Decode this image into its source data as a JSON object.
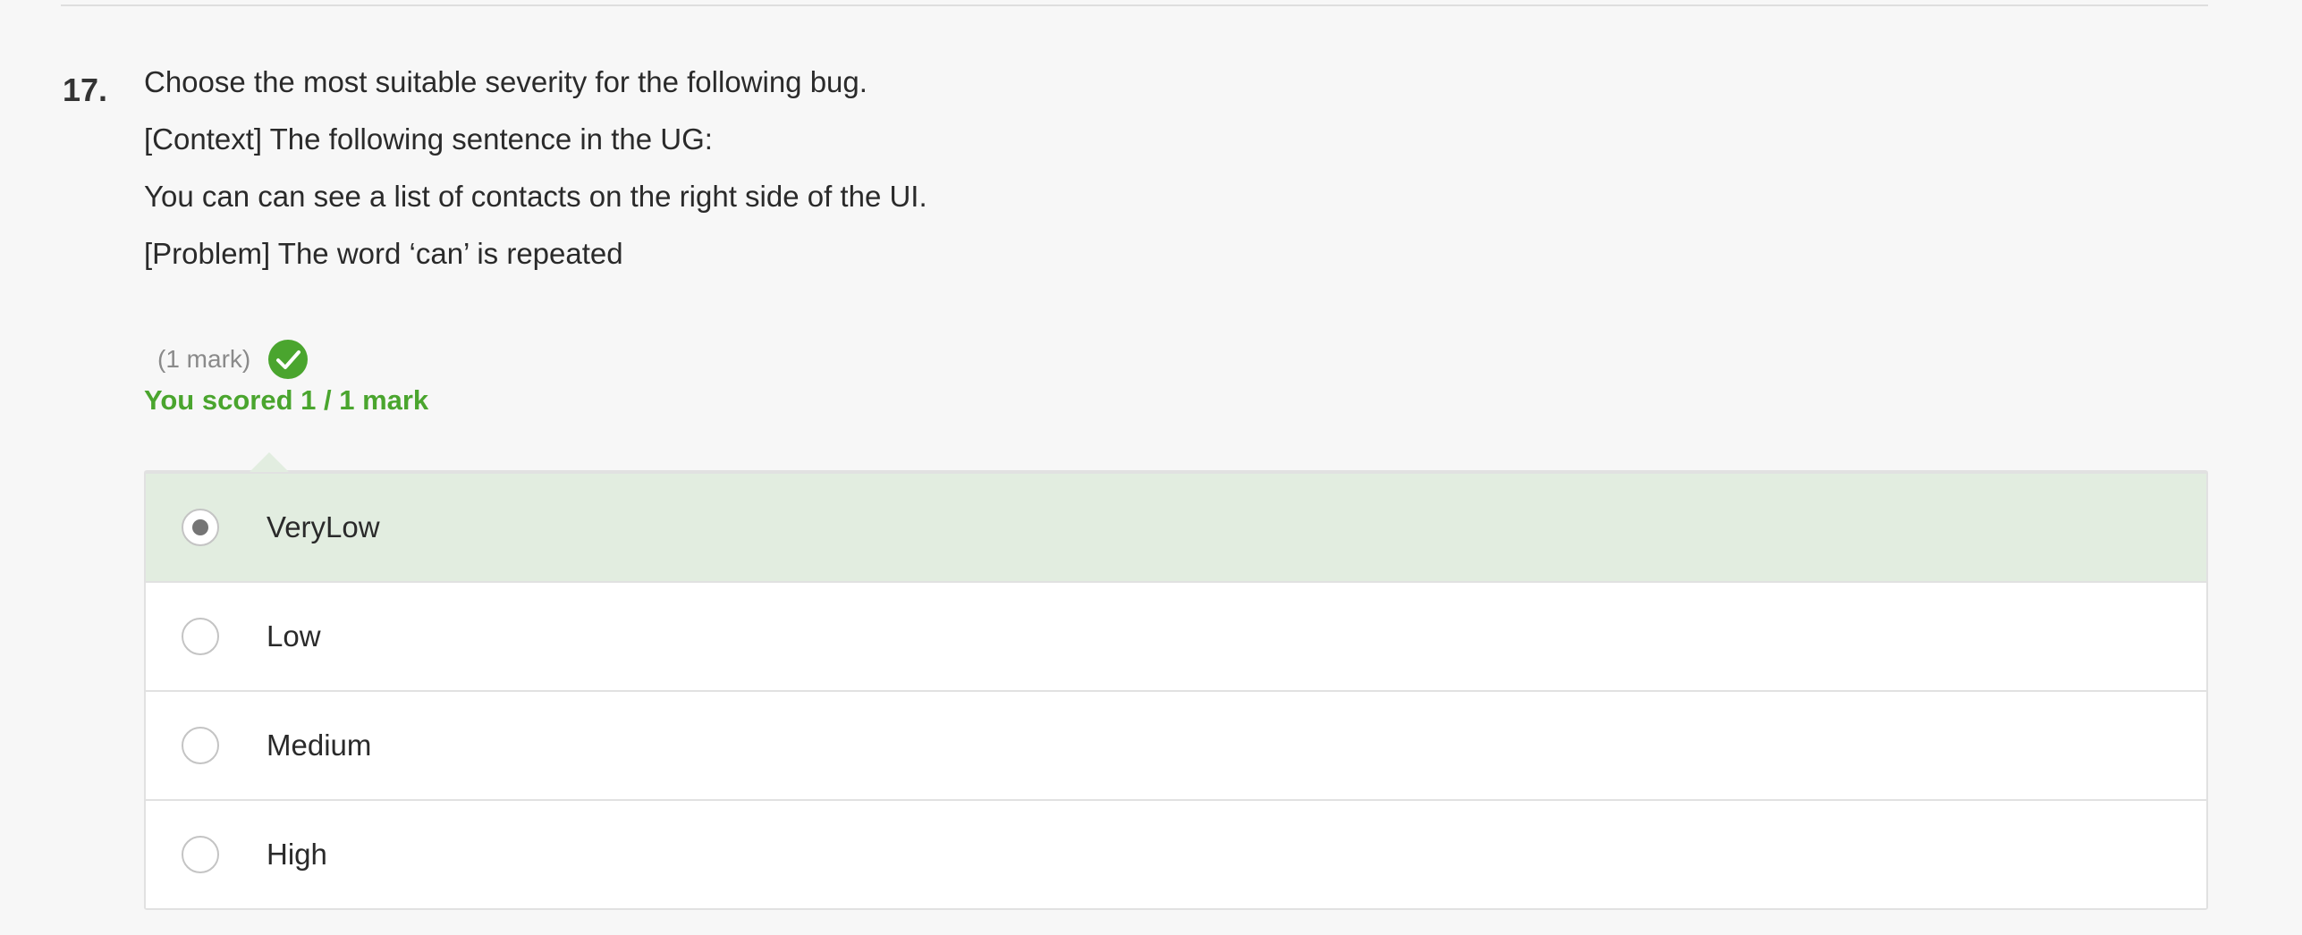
{
  "question": {
    "number": "17.",
    "lines": [
      "Choose the most suitable severity for the following bug.",
      "[Context] The following sentence in the UG:",
      "You can can see a list of contacts on the right side of the UI.",
      "[Problem] The word ‘can’ is repeated"
    ],
    "marks_label": "(1 mark)",
    "status_icon": "check-circle-icon",
    "score_text": "You scored 1 / 1 mark"
  },
  "options": [
    {
      "label": "VeryLow",
      "selected": true
    },
    {
      "label": "Low",
      "selected": false
    },
    {
      "label": "Medium",
      "selected": false
    },
    {
      "label": "High",
      "selected": false
    }
  ],
  "colors": {
    "correct_green": "#4aa52e",
    "selected_bg": "#e2ede0",
    "page_bg": "#f7f7f7"
  }
}
